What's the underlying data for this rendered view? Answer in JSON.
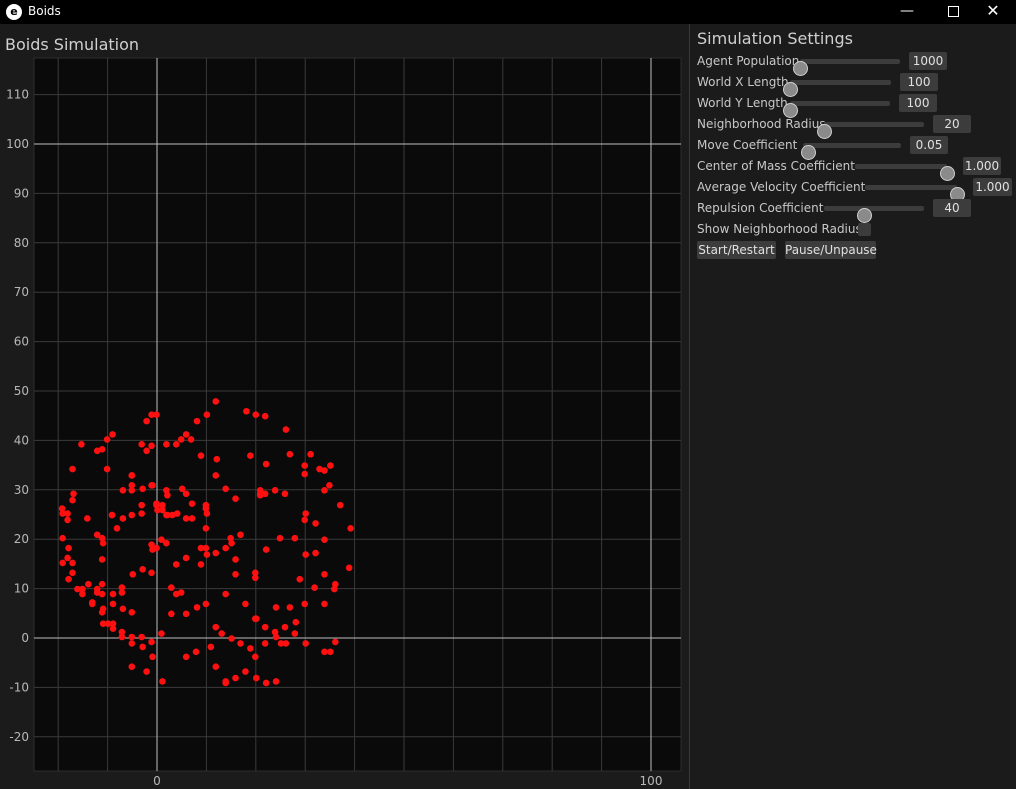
{
  "window": {
    "title": "Boids",
    "app_icon_letter": "e",
    "minimize_label": "—",
    "close_label": "✕"
  },
  "plot": {
    "title": "Boids Simulation",
    "x_ticks": [
      "0",
      "100"
    ],
    "y_ticks": [
      "110",
      "100",
      "90",
      "80",
      "70",
      "60",
      "50",
      "40",
      "30",
      "20",
      "10",
      "0",
      "-10",
      "-20"
    ],
    "grid_color": "#3a3a3a",
    "axis_color": "#bdbdbd",
    "agent_color": "#ff1010",
    "background": "#0a0a0a"
  },
  "settings": {
    "title": "Simulation Settings",
    "agent_population": {
      "label": "Agent Population",
      "value": "1000",
      "fraction": 0.0
    },
    "world_x": {
      "label": "World X Length",
      "value": "100",
      "fraction": 0.0
    },
    "world_y": {
      "label": "World Y Length",
      "value": "100",
      "fraction": 0.0
    },
    "neighborhood_radius": {
      "label": "Neighborhood Radius",
      "value": "20",
      "fraction": 0.0
    },
    "move_coef": {
      "label": "Move Coefficient",
      "value": "0.05",
      "fraction": 0.05
    },
    "com_coef": {
      "label": "Center of Mass Coefficient",
      "value": "1.000",
      "fraction": 1.0
    },
    "avg_vel_coef": {
      "label": "Average Velocity Coefficient",
      "value": "1.000",
      "fraction": 1.0
    },
    "repulsion_coef": {
      "label": "Repulsion Coefficient",
      "value": "40",
      "fraction": 0.4
    },
    "show_radius": {
      "label": "Show Neighborhood Radius",
      "checked": false
    },
    "start_label": "Start/Restart",
    "pause_label": "Pause/Unpause"
  },
  "chart_data": {
    "type": "scatter",
    "title": "Boids Simulation",
    "xlim": [
      -25,
      106
    ],
    "ylim": [
      -27,
      116
    ],
    "grid": true,
    "x": [
      -12.1,
      -7.1,
      -19.2,
      -17.1,
      -15.3,
      -12.1,
      -10.1,
      -9.0,
      -2.1,
      -1.1,
      -0.1,
      1.9,
      4.9,
      8.1,
      10.1,
      11.9,
      18.1,
      20.0,
      21.9,
      26.1,
      26.9,
      31.1,
      34.9,
      37.1,
      39.2,
      38.9,
      36.1,
      33.9,
      28.1,
      24.1,
      20.1,
      19.9,
      19.9,
      22.1,
      24.9,
      27.9,
      30.1,
      33.9,
      32.1,
      29.9,
      30.1,
      35.1,
      36.1,
      33.9,
      26.1,
      25.1,
      24.1,
      22.1,
      20.1,
      18.9,
      16.9,
      15.1,
      13.1,
      11.9,
      9.9,
      8.1,
      5.9,
      3.9,
      2.9,
      4.9,
      8.9,
      13.9,
      15.9,
      15.9,
      9.9,
      7.1,
      7.1,
      10.1,
      9.9,
      5.9,
      4.1,
      2.1,
      1.9,
      -0.9,
      -2.9,
      -5.1,
      -6.9,
      -9.1,
      -11.1,
      -14.1,
      -16.9,
      -17.1,
      -18.1,
      -19.1,
      -19.1,
      -17.9,
      -17.1,
      -15.1,
      -13.1,
      -11.1,
      -9.9,
      -8.9,
      -7.1,
      -5.1,
      -2.9,
      -0.9,
      1.1,
      -2.1,
      -5.1,
      -5.1,
      -7.1,
      -8.9,
      -10.9,
      -10.9,
      -15.1,
      -13.1,
      -11.1,
      -8.9,
      -7.1,
      -4.9,
      -2.9,
      -1.1,
      -1.1,
      -0.1,
      0.9,
      1.9,
      3.9,
      5.9,
      8.9,
      9.9,
      5.9,
      1.9,
      -0.1,
      -3.1,
      -3.1,
      -5.1,
      -5.1,
      -5.1,
      -5.1,
      -6.9,
      -9.1,
      -8.1,
      -10.9,
      -11.1,
      -17.1,
      -18.1,
      -19.1,
      -17.9,
      -16.1,
      -13.9,
      -12.1,
      -11.1,
      -8.9,
      -6.9,
      -5.1,
      -3.1,
      -1.1,
      0.9,
      2.9,
      5.9,
      7.9,
      10.9,
      11.9,
      13.9,
      13.9,
      15.9,
      17.9,
      19.9,
      21.9,
      23.9,
      25.9,
      27.9,
      29.9,
      31.9,
      33.9,
      35.9,
      17.9,
      19.9,
      21.9,
      24.1,
      26.9,
      28.9,
      30.1,
      32.1,
      33.9,
      -12.1,
      -18.1,
      -0.1,
      2.1,
      -1.1,
      1.1,
      20.9,
      22.1,
      29.9,
      33.9,
      35.1,
      32.9,
      29.9,
      25.9,
      23.9,
      21.9,
      20.9,
      20.9,
      15.9,
      13.9,
      11.9,
      9.9,
      3.1,
      0.1,
      -3.1,
      -11.1,
      -10.1,
      5.9,
      6.9,
      3.9,
      18.9,
      12.1,
      8.9,
      -2.1,
      -1.1,
      1.1,
      5.1,
      14.9,
      16.9,
      15.1,
      13.9,
      11.9,
      10.1,
      -0.9
    ],
    "y": [
      9.2,
      10.2,
      26.2,
      34.2,
      39.2,
      37.9,
      34.2,
      41.2,
      43.9,
      45.2,
      45.2,
      39.2,
      40.2,
      43.9,
      45.2,
      47.9,
      45.9,
      45.2,
      44.9,
      42.2,
      37.2,
      37.2,
      30.9,
      26.9,
      22.2,
      14.2,
      10.9,
      6.9,
      3.2,
      6.2,
      3.9,
      12.2,
      13.2,
      17.9,
      20.2,
      20.2,
      25.2,
      29.9,
      23.2,
      23.9,
      -1.1,
      -2.8,
      -0.8,
      -2.8,
      -1.1,
      -1.1,
      -8.8,
      -9.1,
      -8.1,
      -2.1,
      -1.1,
      -0.1,
      0.9,
      2.2,
      6.9,
      6.2,
      4.9,
      8.9,
      10.2,
      9.2,
      14.9,
      8.9,
      12.9,
      15.9,
      18.2,
      24.2,
      27.2,
      25.2,
      26.9,
      29.2,
      25.2,
      24.9,
      29.9,
      30.9,
      30.2,
      32.9,
      29.9,
      24.9,
      20.2,
      24.2,
      29.2,
      27.9,
      25.2,
      25.2,
      20.2,
      18.2,
      15.2,
      9.9,
      7.2,
      5.2,
      2.9,
      1.9,
      1.2,
      0.2,
      -1.8,
      -3.8,
      -8.8,
      -6.8,
      -5.8,
      -1.1,
      0.2,
      2.9,
      2.9,
      5.9,
      8.9,
      6.9,
      8.9,
      6.9,
      9.2,
      12.9,
      13.9,
      13.2,
      18.9,
      18.2,
      19.9,
      19.2,
      14.9,
      16.2,
      18.2,
      22.2,
      24.2,
      24.9,
      27.2,
      25.2,
      26.9,
      30.9,
      32.9,
      29.9,
      24.9,
      24.2,
      24.9,
      22.2,
      19.2,
      15.9,
      13.2,
      16.2,
      15.2,
      11.9,
      9.9,
      10.9,
      9.9,
      10.9,
      8.9,
      5.9,
      5.2,
      0.2,
      -0.8,
      0.9,
      4.9,
      -3.8,
      -2.8,
      -1.8,
      -5.8,
      -9.1,
      -8.8,
      -8.1,
      -6.8,
      -3.8,
      -1.1,
      1.2,
      2.2,
      0.9,
      6.9,
      10.2,
      12.9,
      9.9,
      6.9,
      3.9,
      2.2,
      0.2,
      6.2,
      11.9,
      16.9,
      17.2,
      19.9,
      20.9,
      23.9,
      26.9,
      28.9,
      30.9,
      26.9,
      29.9,
      35.2,
      34.9,
      33.9,
      34.9,
      34.2,
      33.2,
      29.2,
      29.9,
      29.2,
      28.9,
      29.2,
      28.2,
      30.2,
      32.9,
      26.2,
      24.9,
      25.9,
      39.2,
      38.2,
      40.2,
      41.2,
      40.2,
      39.2,
      36.9,
      36.2,
      36.9,
      37.9,
      38.9,
      25.9,
      30.2,
      20.2,
      20.9,
      19.2,
      18.2,
      17.2,
      16.9,
      17.9,
      18.2,
      13.2,
      12.9,
      10.2,
      7.2,
      4.9,
      -1.1,
      -4.8,
      -3.8,
      -5.1,
      -6.1,
      -6.8,
      -7.8,
      15.9
    ]
  }
}
